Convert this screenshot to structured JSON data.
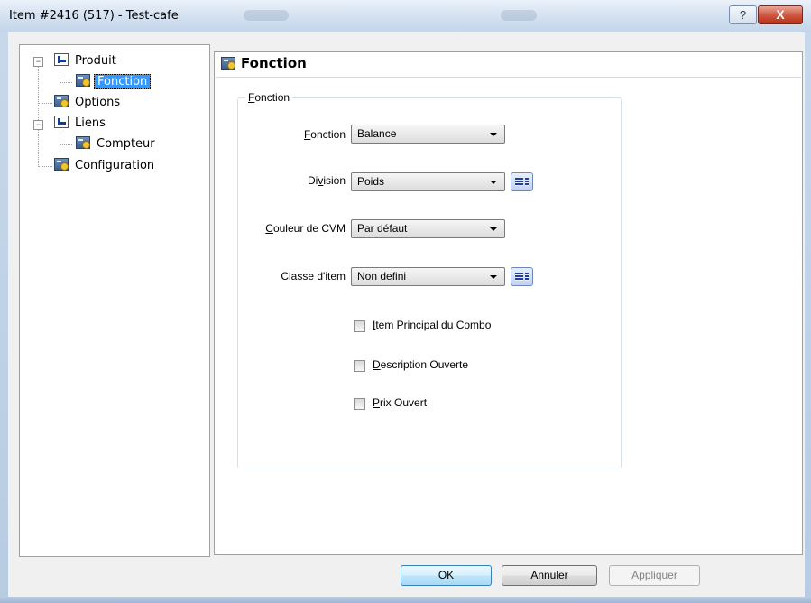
{
  "window": {
    "title": "Item #2416 (517) - Test-cafe",
    "help_glyph": "?",
    "close_glyph": "X"
  },
  "tree": {
    "items": [
      {
        "label": "Produit",
        "icon": "product-icon",
        "expander": "−"
      },
      {
        "label": "Fonction",
        "icon": "function-icon"
      },
      {
        "label": "Options",
        "icon": "function-icon"
      },
      {
        "label": "Liens",
        "icon": "product-icon",
        "expander": "−"
      },
      {
        "label": "Compteur",
        "icon": "function-icon"
      },
      {
        "label": "Configuration",
        "icon": "function-icon"
      }
    ]
  },
  "panel": {
    "header": "Fonction",
    "group": {
      "label_first": "F",
      "label_rest": "onction"
    },
    "fields": {
      "fonction": {
        "label_first": "F",
        "label_rest": "onction",
        "value": "Balance"
      },
      "division": {
        "label_before": "Di",
        "label_access": "v",
        "label_after": "ision",
        "value": "Poids"
      },
      "couleur": {
        "label_first": "C",
        "label_rest": "ouleur de CVM",
        "value": "Par défaut"
      },
      "classe": {
        "label": "Classe d'item",
        "value": "Non defini"
      }
    },
    "checkboxes": [
      {
        "label_first": "I",
        "label_rest": "tem Principal du Combo",
        "checked": false
      },
      {
        "label_first": "D",
        "label_rest": "escription Ouverte",
        "checked": false
      },
      {
        "label_first": "P",
        "label_rest": "rix Ouvert",
        "checked": false
      }
    ]
  },
  "buttons": {
    "ok": "OK",
    "cancel": "Annuler",
    "apply": "Appliquer"
  },
  "colors": {
    "selection": "#3399ff",
    "default_button_border": "#3c7fb1",
    "close_button": "#c8462e"
  }
}
